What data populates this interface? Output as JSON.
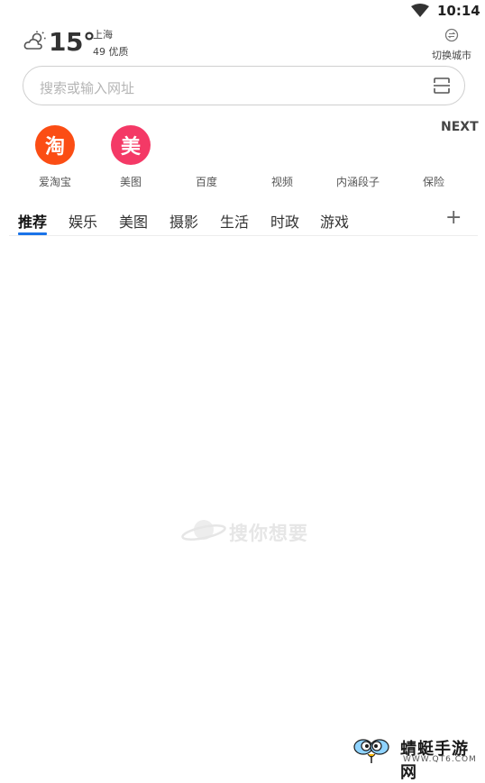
{
  "status_bar": {
    "time": "10:14",
    "wifi_icon": "wifi-icon"
  },
  "weather": {
    "icon": "cloud-sun-icon",
    "temperature": "15°",
    "city": "上海",
    "air_quality": "49 优质",
    "switch_icon": "switch-city-icon",
    "switch_label": "切换城市"
  },
  "search": {
    "placeholder": "搜索或输入网址",
    "scan_icon": "scan-icon"
  },
  "shortcuts": {
    "next_label": "NEXT",
    "items": [
      {
        "label": "爱淘宝",
        "icon_text": "淘",
        "color": "#fb4d14"
      },
      {
        "label": "美图",
        "icon_text": "美",
        "color": "#f43966"
      },
      {
        "label": "百度"
      },
      {
        "label": "视频"
      },
      {
        "label": "内涵段子"
      },
      {
        "label": "保险"
      }
    ]
  },
  "tabs": {
    "items": [
      "推荐",
      "娱乐",
      "美图",
      "摄影",
      "生活",
      "时政",
      "游戏"
    ],
    "active_index": 0,
    "add_label": "+"
  },
  "loading": {
    "text": "搜你想要"
  },
  "watermark": {
    "name": "蜻蜓手游网",
    "url": "WWW.QT6.COM"
  },
  "colors": {
    "accent": "#1a73e8",
    "taobao": "#fb4d14",
    "meitu": "#f43966"
  }
}
